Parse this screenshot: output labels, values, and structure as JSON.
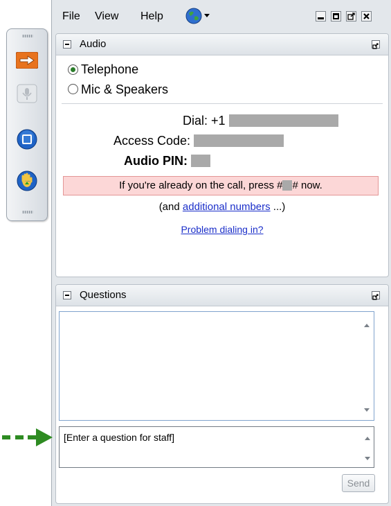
{
  "menu": {
    "file": "File",
    "view": "View",
    "help": "Help"
  },
  "audio": {
    "title": "Audio",
    "option_telephone": "Telephone",
    "option_mic": "Mic & Speakers",
    "selected": "Telephone",
    "dial_label": "Dial:",
    "dial_prefix": "+1",
    "access_code_label": "Access Code:",
    "audio_pin_label": "Audio PIN:",
    "already_on_call_prefix": "If you're already on the call, press #",
    "already_on_call_suffix": "# now.",
    "additional_prefix": "(and ",
    "additional_link": "additional numbers",
    "additional_suffix": " ...)",
    "problem_link": "Problem dialing in?"
  },
  "questions": {
    "title": "Questions",
    "input_value": "[Enter a question for staff]",
    "send_label": "Send"
  },
  "colors": {
    "arrow_green": "#2e8b22",
    "warning_bg": "#fcd7d7",
    "link": "#1a2ec9",
    "accent_orange": "#e8731e"
  }
}
